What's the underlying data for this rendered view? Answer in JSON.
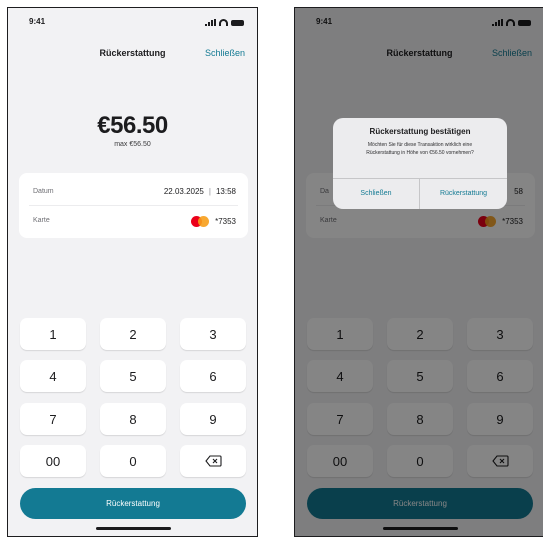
{
  "screens": [
    {
      "status": {
        "time": "9:41"
      },
      "nav": {
        "title": "Rückerstattung",
        "close": "Schließen"
      },
      "amount": {
        "value": "€56.50",
        "max": "max €56.50"
      },
      "details": {
        "date_label": "Datum",
        "date": "22.03.2025",
        "separator": "|",
        "time": "13:58",
        "card_label": "Karte",
        "card_suffix": "*7353"
      },
      "keypad": [
        "1",
        "2",
        "3",
        "4",
        "5",
        "6",
        "7",
        "8",
        "9",
        "00",
        "0"
      ],
      "primary_button": "Rückerstattung"
    },
    {
      "status": {
        "time": "9:41"
      },
      "nav": {
        "title": "Rückerstattung",
        "close": "Schließen"
      },
      "details": {
        "date_label": "Da",
        "time_partial": "58",
        "card_label": "Karte",
        "card_suffix": "*7353"
      },
      "keypad": [
        "1",
        "2",
        "3",
        "4",
        "5",
        "6",
        "7",
        "8",
        "9",
        "00",
        "0"
      ],
      "primary_button": "Rückerstattung",
      "dialog": {
        "title": "Rückerstattung bestätigen",
        "message": "Möchten Sie für diese Transaktion wirklich eine Rückerstattung in Höhe von €56.50 vornehmen?",
        "cancel": "Schließen",
        "confirm": "Rückerstattung"
      }
    }
  ],
  "icons": {
    "backspace": "backspace-icon",
    "card_brand": "mastercard-icon"
  },
  "colors": {
    "accent": "#137a93",
    "background": "#f2f2f4",
    "card": "#ffffff",
    "overlay": "rgba(0,0,0,0.48)"
  }
}
